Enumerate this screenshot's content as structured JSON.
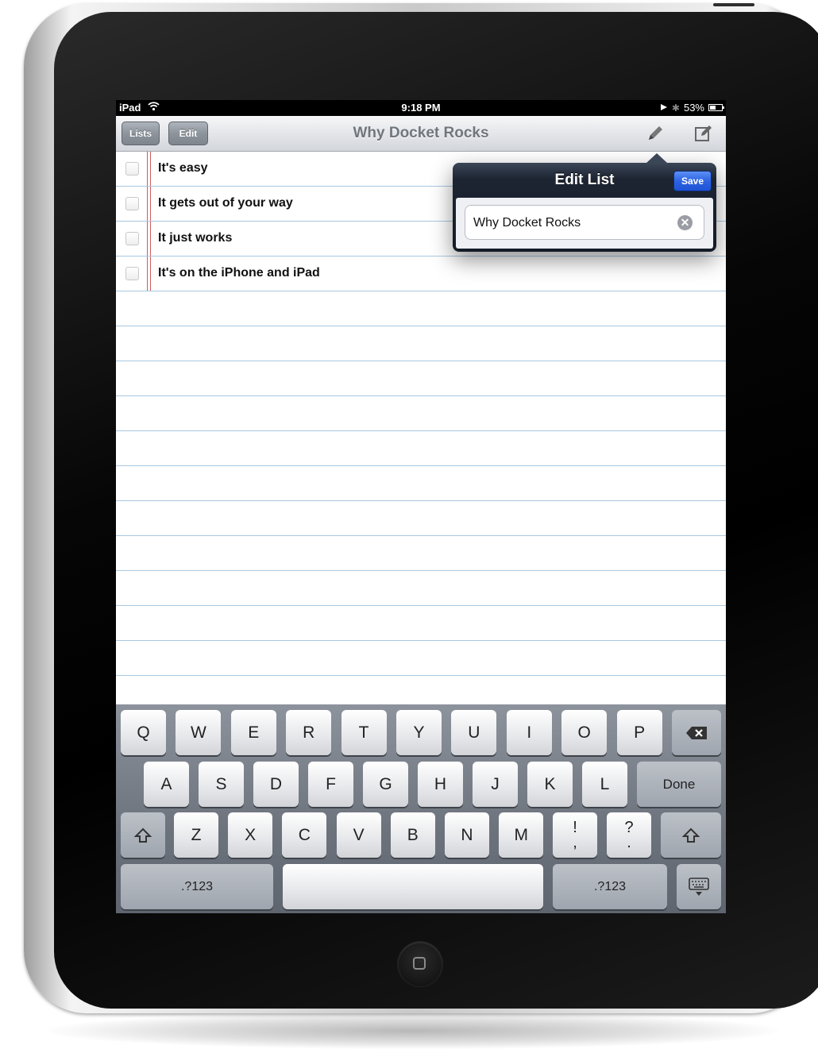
{
  "status_bar": {
    "carrier": "iPad",
    "time": "9:18 PM",
    "battery": "53%",
    "battery_level": 0.53
  },
  "nav": {
    "lists_label": "Lists",
    "edit_label": "Edit",
    "title": "Why Docket Rocks"
  },
  "items": [
    {
      "text": "It's easy"
    },
    {
      "text": "It gets out of your way"
    },
    {
      "text": "It just works"
    },
    {
      "text": "It's on the iPhone and iPad"
    }
  ],
  "popover": {
    "title": "Edit List",
    "save_label": "Save",
    "field_value": "Why Docket Rocks"
  },
  "keyboard": {
    "row1": [
      "Q",
      "W",
      "E",
      "R",
      "T",
      "Y",
      "U",
      "I",
      "O",
      "P"
    ],
    "row2": [
      "A",
      "S",
      "D",
      "F",
      "G",
      "H",
      "J",
      "K",
      "L"
    ],
    "row3": [
      "Z",
      "X",
      "C",
      "V",
      "B",
      "N",
      "M"
    ],
    "punct1_top": "!",
    "punct1_bottom": ",",
    "punct2_top": "?",
    "punct2_bottom": ".",
    "done_label": "Done",
    "numbers_label": ".?123"
  },
  "icons": {
    "wifi": "wifi-icon",
    "location": "location-arrow-icon",
    "bluetooth": "bluetooth-icon",
    "battery": "battery-icon",
    "pencil": "pencil-icon",
    "compose": "compose-icon",
    "clear": "clear-icon",
    "backspace": "backspace-icon",
    "shift": "shift-icon",
    "dismiss_keyboard": "keyboard-dismiss-icon",
    "home": "home-button-icon"
  }
}
